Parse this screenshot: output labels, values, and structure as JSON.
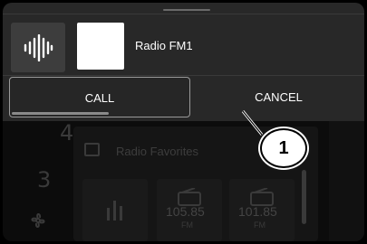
{
  "now_playing": {
    "station": "Radio FM1",
    "wave_icon": "audio-wave-icon",
    "art_icon": "album-art-placeholder"
  },
  "dialog": {
    "call_label": "CALL",
    "cancel_label": "CANCEL",
    "call_timer_progress": 0.55
  },
  "callout": {
    "number": "1"
  },
  "background": {
    "side_numbers": [
      "4",
      "3"
    ],
    "side_icon": "fan-icon",
    "favorites_title": "Radio Favorites",
    "favorites_icon": "radio-favorites-icon",
    "presets": [
      {
        "freq": "105.85",
        "band": "FM"
      },
      {
        "freq": "101.85",
        "band": "FM"
      }
    ]
  }
}
